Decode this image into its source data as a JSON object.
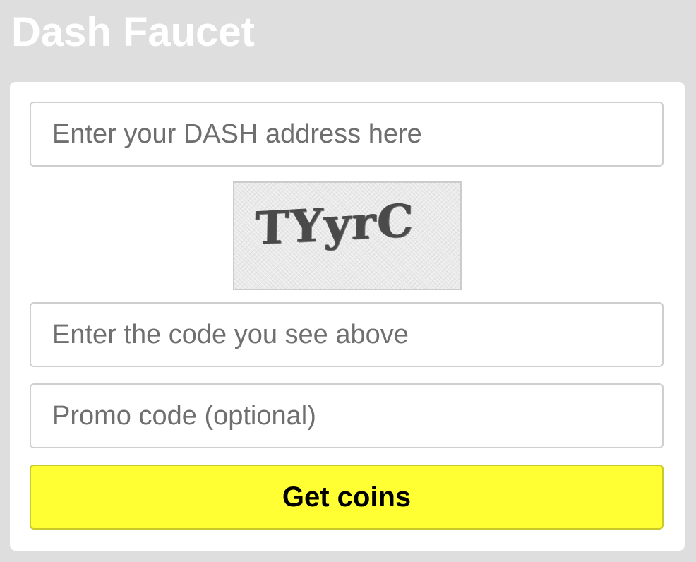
{
  "header": {
    "title": "Dash Faucet"
  },
  "form": {
    "address_placeholder": "Enter your DASH address here",
    "address_value": "",
    "captcha_text": "TYyrC",
    "code_placeholder": "Enter the code you see above",
    "code_value": "",
    "promo_placeholder": "Promo code (optional)",
    "promo_value": "",
    "submit_label": "Get coins"
  },
  "colors": {
    "page_background": "#dedede",
    "card_background": "#ffffff",
    "button_background": "#ffff33",
    "title_color": "#ffffff"
  }
}
